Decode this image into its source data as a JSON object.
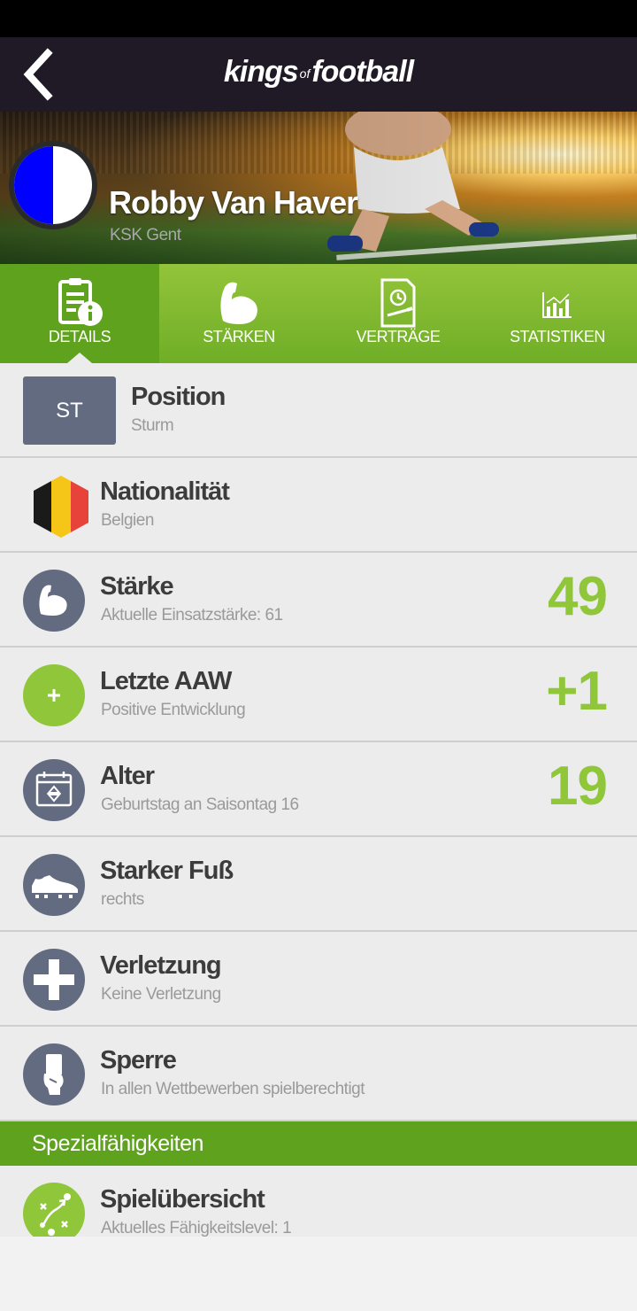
{
  "app": {
    "logo_left": "kings",
    "logo_of": "of",
    "logo_right": "football"
  },
  "player": {
    "name": "Robby Van Haver",
    "club": "KSK Gent"
  },
  "tabs": [
    {
      "label": "DETAILS",
      "icon": "document-info-icon",
      "active": true
    },
    {
      "label": "STÄRKEN",
      "icon": "flexed-arm-icon",
      "active": false
    },
    {
      "label": "VERTRÄGE",
      "icon": "contract-clock-icon",
      "active": false
    },
    {
      "label": "STATISTIKEN",
      "icon": "bar-chart-icon",
      "active": false
    }
  ],
  "details": {
    "position": {
      "badge": "ST",
      "title": "Position",
      "sub": "Sturm"
    },
    "nationality": {
      "title": "Nationalität",
      "sub": "Belgien",
      "flag_colors": [
        "#1a1a1a",
        "#f5c518",
        "#e8433a"
      ]
    },
    "strength": {
      "title": "Stärke",
      "sub": "Aktuelle Einsatzstärke: 61",
      "value": "49"
    },
    "last_aaw": {
      "title": "Letzte AAW",
      "sub": "Positive Entwicklung",
      "value": "+1"
    },
    "age": {
      "title": "Alter",
      "sub": "Geburtstag an Saisontag 16",
      "value": "19"
    },
    "foot": {
      "title": "Starker Fuß",
      "sub": "rechts"
    },
    "injury": {
      "title": "Verletzung",
      "sub": "Keine Verletzung"
    },
    "suspension": {
      "title": "Sperre",
      "sub": "In allen Wettbewerben spielberechtigt"
    }
  },
  "special": {
    "heading": "Spezialfähigkeiten",
    "items": [
      {
        "title": "Spielübersicht",
        "sub": "Aktuelles Fähigkeitslevel: 1"
      }
    ]
  },
  "colors": {
    "accent_green": "#8fc63a",
    "dark_green": "#5fa21d",
    "icon_slate": "#626b80",
    "appbar": "#1f1a26"
  }
}
